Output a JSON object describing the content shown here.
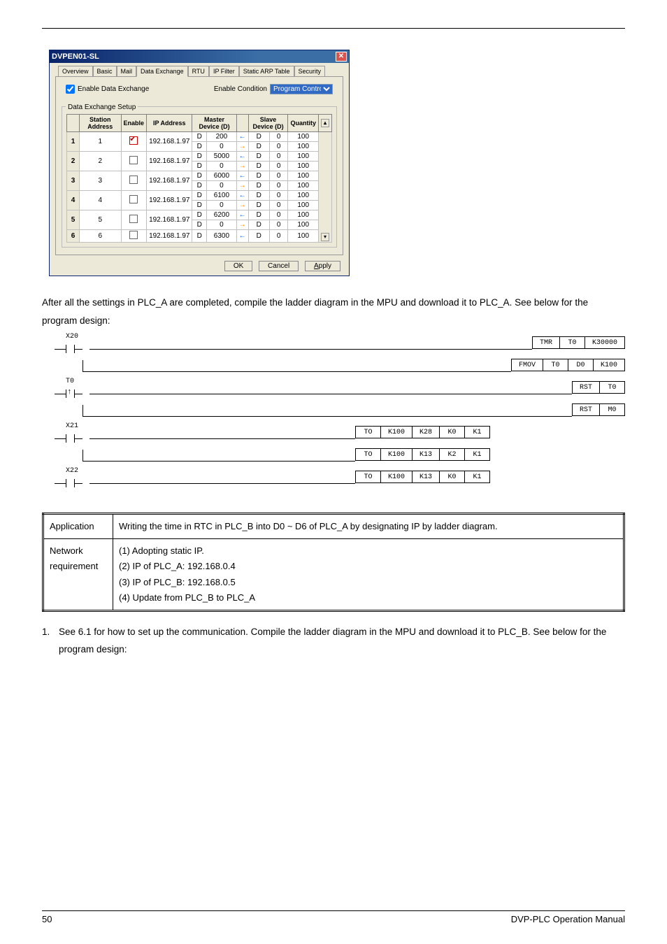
{
  "dialog": {
    "title": "DVPEN01-SL",
    "tabs": [
      "Overview",
      "Basic",
      "Mail",
      "Data Exchange",
      "RTU",
      "IP Filter",
      "Static ARP Table",
      "Security"
    ],
    "active_tab": 3,
    "enable_label": "Enable Data Exchange",
    "enable_checked": true,
    "cond_label": "Enable Condition",
    "cond_value": "Program Control",
    "fieldset": "Data Exchange Setup",
    "headers": [
      "",
      "Station Address",
      "Enable",
      "IP Address",
      "Master Device (D)",
      "",
      "Slave Device (D)",
      "Quantity",
      ""
    ],
    "rows": [
      {
        "n": "1",
        "sa": "1",
        "en": true,
        "ip": "192.168.1.97",
        "m1l": "D",
        "m1v": "200",
        "a1": "←",
        "s1l": "D",
        "s1v": "0",
        "q1": "100",
        "m2l": "D",
        "m2v": "0",
        "a2": "→",
        "s2l": "D",
        "s2v": "0",
        "q2": "100"
      },
      {
        "n": "2",
        "sa": "2",
        "en": false,
        "ip": "192.168.1.97",
        "m1l": "D",
        "m1v": "5000",
        "a1": "←",
        "s1l": "D",
        "s1v": "0",
        "q1": "100",
        "m2l": "D",
        "m2v": "0",
        "a2": "→",
        "s2l": "D",
        "s2v": "0",
        "q2": "100"
      },
      {
        "n": "3",
        "sa": "3",
        "en": false,
        "ip": "192.168.1.97",
        "m1l": "D",
        "m1v": "6000",
        "a1": "←",
        "s1l": "D",
        "s1v": "0",
        "q1": "100",
        "m2l": "D",
        "m2v": "0",
        "a2": "→",
        "s2l": "D",
        "s2v": "0",
        "q2": "100"
      },
      {
        "n": "4",
        "sa": "4",
        "en": false,
        "ip": "192.168.1.97",
        "m1l": "D",
        "m1v": "6100",
        "a1": "←",
        "s1l": "D",
        "s1v": "0",
        "q1": "100",
        "m2l": "D",
        "m2v": "0",
        "a2": "→",
        "s2l": "D",
        "s2v": "0",
        "q2": "100"
      },
      {
        "n": "5",
        "sa": "5",
        "en": false,
        "ip": "192.168.1.97",
        "m1l": "D",
        "m1v": "6200",
        "a1": "←",
        "s1l": "D",
        "s1v": "0",
        "q1": "100",
        "m2l": "D",
        "m2v": "0",
        "a2": "→",
        "s2l": "D",
        "s2v": "0",
        "q2": "100"
      },
      {
        "n": "6",
        "sa": "6",
        "en": false,
        "ip": "192.168.1.97",
        "m1l": "D",
        "m1v": "6300",
        "a1": "←",
        "s1l": "D",
        "s1v": "0",
        "q1": "100"
      }
    ],
    "buttons": {
      "ok": "OK",
      "cancel": "Cancel",
      "apply": "Apply"
    }
  },
  "para1": "After all the settings in PLC_A are completed, compile the ladder diagram in the MPU and download it to PLC_A. See below for the program design:",
  "ladder": {
    "r1": {
      "c": "X20",
      "i1": [
        "TMR",
        "T0",
        "K30000"
      ],
      "i2": [
        "FMOV",
        "T0",
        "D0",
        "K100"
      ]
    },
    "r2": {
      "c": "T0",
      "i1": [
        "RST",
        "T0"
      ],
      "i2": [
        "RST",
        "M0"
      ]
    },
    "r3": {
      "c": "X21",
      "i1": [
        "TO",
        "K100",
        "K28",
        "K0",
        "K1"
      ],
      "i2": [
        "TO",
        "K100",
        "K13",
        "K2",
        "K1"
      ]
    },
    "r4": {
      "c": "X22",
      "i1": [
        "TO",
        "K100",
        "K13",
        "K0",
        "K1"
      ]
    }
  },
  "info": {
    "l1": "Application",
    "v1": "Writing the time in RTC in PLC_B into D0 ~ D6 of PLC_A by designating IP by ladder diagram.",
    "l2": "Network requirement",
    "v2a": "(1) Adopting static IP.",
    "v2b": "(2) IP of PLC_A: 192.168.0.4",
    "v2c": "(3) IP of PLC_B: 192.168.0.5",
    "v2d": "(4) Update from PLC_B to PLC_A"
  },
  "list1": {
    "n": "1.",
    "t": "See 6.1 for how to set up the communication. Compile the ladder diagram in the MPU and download it to PLC_B. See below for the program design:"
  },
  "footer": {
    "page": "50",
    "title": "DVP-PLC Operation Manual"
  }
}
